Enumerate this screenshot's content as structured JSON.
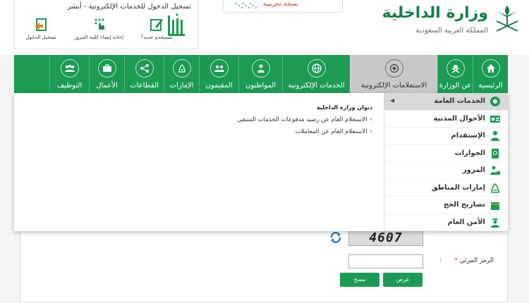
{
  "header": {
    "absher_title": "تسجيل الدخول للخدمات الإلكترونية - أبشر",
    "absher_links": [
      {
        "label": "مستخدم جديد؟",
        "icon": "new-user-icon"
      },
      {
        "label": "إعادة إنشاء كلمة المرور",
        "icon": "reset-password-icon"
      },
      {
        "label": "تسجيل الدخول",
        "icon": "login-icon"
      }
    ],
    "trial_label": "نسخة تجريبية",
    "ministry_name": "وزارة الداخلية",
    "ministry_sub": "المملكة العربية السعودية"
  },
  "nav": {
    "items": [
      {
        "label": "الرئيسية",
        "icon": "home-icon"
      },
      {
        "label": "عن الوزارة",
        "icon": "ministry-emblem-icon"
      },
      {
        "label": "الاستعلامات الإلكترونية",
        "icon": "inquiry-icon",
        "active": true
      },
      {
        "label": "الخدمات الإلكترونية",
        "icon": "globe-icon"
      },
      {
        "label": "المواطنون",
        "icon": "citizen-icon"
      },
      {
        "label": "المقيمون",
        "icon": "residents-icon"
      },
      {
        "label": "الإمارات",
        "icon": "emirates-icon"
      },
      {
        "label": "القطاعات",
        "icon": "sectors-icon"
      },
      {
        "label": "الأعمال",
        "icon": "briefcase-icon"
      },
      {
        "label": "التوظيف",
        "icon": "employment-icon"
      }
    ]
  },
  "dropdown": {
    "side_items": [
      {
        "label": "الخدمات العامة",
        "icon": "general-services-icon"
      },
      {
        "label": "الأحوال المدنية",
        "icon": "civil-affairs-icon"
      },
      {
        "label": "الإستقدام",
        "icon": "recruitment-icon"
      },
      {
        "label": "الجوازات",
        "icon": "passport-icon"
      },
      {
        "label": "المرور",
        "icon": "traffic-icon"
      },
      {
        "label": "إمارات المناطق",
        "icon": "regions-icon"
      },
      {
        "label": "تصاريح الحج",
        "icon": "hajj-icon"
      },
      {
        "label": "الأمن العام",
        "icon": "public-security-icon"
      }
    ],
    "panel_title": "ديوان وزارة الداخلية",
    "panel_links": [
      "الاستعلام العام عن رصيد مدفوعات الخدمات المتبقي",
      "الاستعلام العام عن المعاملات"
    ]
  },
  "form": {
    "captcha_text": "4607",
    "code_label": "الرمز المرئي",
    "required_mark": "*",
    "colon": ":",
    "code_value": "",
    "show_button": "عرض",
    "clear_button": "مسح"
  },
  "colors": {
    "primary": "#1c9b55",
    "ministry_green": "#177e4b",
    "active_tab": "#c8c8c8"
  }
}
